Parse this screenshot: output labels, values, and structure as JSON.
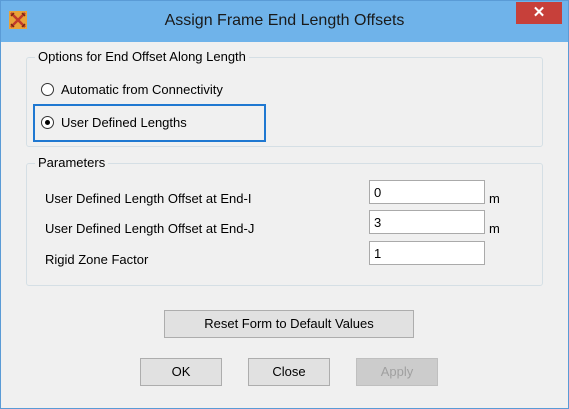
{
  "window": {
    "title": "Assign Frame End Length Offsets",
    "close_glyph": "✕",
    "app_icon": "sap-logo-icon"
  },
  "options_group": {
    "title": "Options for End Offset Along Length",
    "options": [
      {
        "label": "Automatic from Connectivity",
        "selected": false
      },
      {
        "label": "User Defined Lengths",
        "selected": true
      }
    ]
  },
  "parameters_group": {
    "title": "Parameters",
    "rows": [
      {
        "label": "User Defined Length Offset at End-I",
        "value": "0",
        "unit": "m"
      },
      {
        "label": "User Defined Length Offset at End-J",
        "value": "3",
        "unit": "m"
      },
      {
        "label": "Rigid Zone Factor",
        "value": "1",
        "unit": ""
      }
    ]
  },
  "buttons": {
    "reset": "Reset Form to Default Values",
    "ok": "OK",
    "close": "Close",
    "apply": "Apply"
  },
  "colors": {
    "titlebar": "#6fb3ea",
    "close_button": "#c7403a",
    "highlight": "#1f78d1"
  }
}
